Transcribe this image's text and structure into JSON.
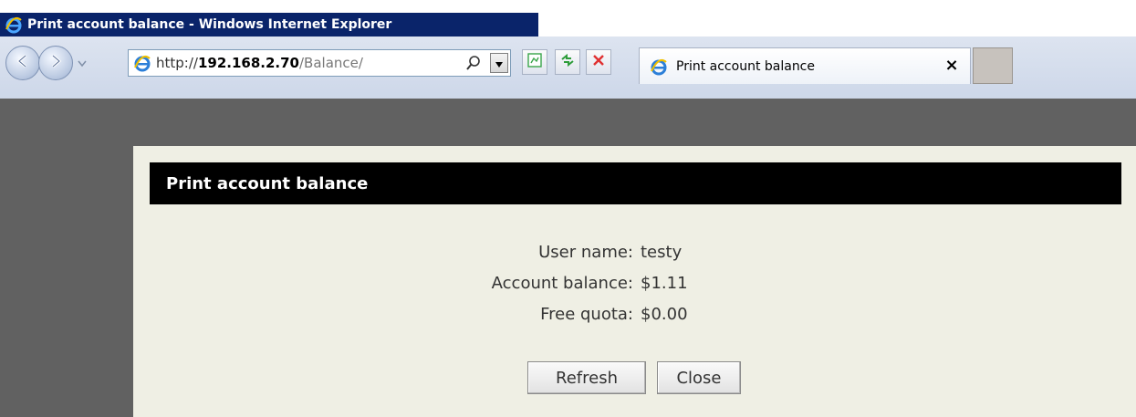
{
  "window": {
    "title": "Print account balance - Windows Internet Explorer"
  },
  "toolbar": {
    "address": {
      "scheme": "http://",
      "host": "192.168.2.70",
      "path": "/Balance/"
    },
    "tab": {
      "label": "Print account balance",
      "close_glyph": "×"
    }
  },
  "page": {
    "header": "Print account balance",
    "fields": [
      {
        "label": "User name:",
        "value": "testy"
      },
      {
        "label": "Account balance:",
        "value": "$1.11"
      },
      {
        "label": "Free quota:",
        "value": "$0.00"
      }
    ],
    "buttons": {
      "refresh": "Refresh",
      "close": "Close"
    }
  },
  "colors": {
    "title_bar": "#0a246a",
    "content_background": "#616161",
    "panel_background": "#efefe4",
    "header_background": "#000000"
  },
  "icons": {
    "title": "ie-logo-icon",
    "back": "back-arrow-icon",
    "forward": "forward-arrow-icon",
    "search": "search-icon",
    "compat": "compatibility-view-icon",
    "refresh": "refresh-icon",
    "stop": "stop-icon"
  }
}
